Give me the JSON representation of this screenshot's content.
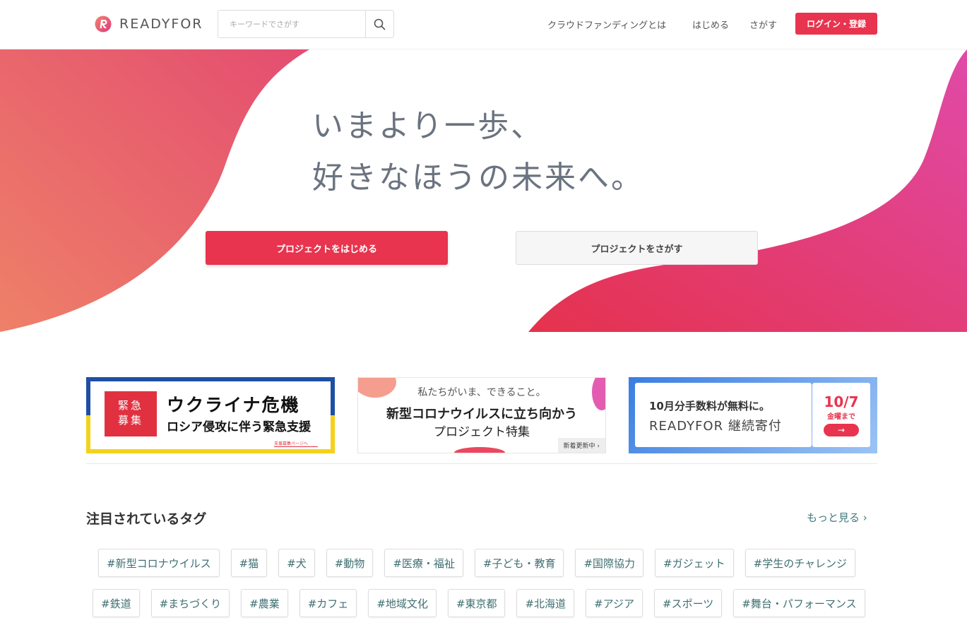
{
  "header": {
    "logo_text": "READYFOR",
    "search_placeholder": "キーワードでさがす",
    "nav": [
      "クラウドファンディングとは",
      "はじめる",
      "さがす"
    ],
    "login_label": "ログイン・登録"
  },
  "hero": {
    "line1": "いまより一歩、",
    "line2": "好きなほうの未来へ。",
    "primary_cta": "プロジェクトをはじめる",
    "secondary_cta": "プロジェクトをさがす",
    "colors": {
      "accent": "#e8344e",
      "pink": "#e0489e",
      "coral": "#ee7f6a"
    }
  },
  "banners": {
    "ukraine": {
      "badge_line1": "緊急",
      "badge_line2": "募集",
      "title": "ウクライナ危機",
      "subtitle": "ロシア侵攻に伴う緊急支援",
      "link": "支援募集ページへ"
    },
    "corona": {
      "top": "私たちがいま、できること。",
      "main": "新型コロナウイルスに立ち向かう",
      "sub": "プロジェクト特集",
      "tag": "新着更新中"
    },
    "donation": {
      "line1": "10月分手数料が無料に。",
      "line2": "READYFOR 継続寄付",
      "date": "10/7",
      "until": "金曜まで"
    }
  },
  "tags_section": {
    "title": "注目されているタグ",
    "more": "もっと見る",
    "row1": [
      "#新型コロナウイルス",
      "#猫",
      "#犬",
      "#動物",
      "#医療・福祉",
      "#子ども・教育",
      "#国際協力",
      "#ガジェット",
      "#学生のチャレンジ"
    ],
    "row2": [
      "#鉄道",
      "#まちづくり",
      "#農業",
      "#カフェ",
      "#地域文化",
      "#東京都",
      "#北海道",
      "#アジア",
      "#スポーツ",
      "#舞台・パフォーマンス"
    ]
  }
}
